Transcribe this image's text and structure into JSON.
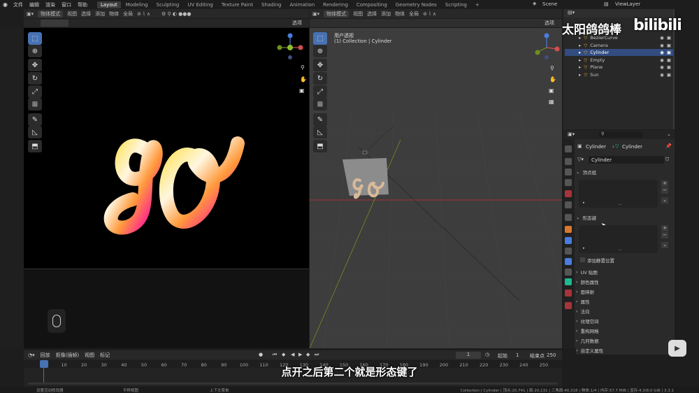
{
  "topbar": {
    "menu": [
      "文件",
      "编辑",
      "渲染",
      "窗口",
      "帮助"
    ],
    "workspaces": [
      "Layout",
      "Modeling",
      "Sculpting",
      "UV Editing",
      "Texture Paint",
      "Shading",
      "Animation",
      "Rendering",
      "Compositing",
      "Geometry Nodes",
      "Scripting"
    ],
    "active_workspace": "Layout",
    "add_tab": "+",
    "scene": "Scene",
    "view_layer": "ViewLayer"
  },
  "left_viewport": {
    "mode": "物体模式",
    "menus": [
      "视图",
      "选择",
      "添加",
      "物体"
    ],
    "transform": "全局",
    "options": "选项",
    "artwork_text": "go"
  },
  "right_viewport": {
    "mode": "物体模式",
    "menus": [
      "视图",
      "选择",
      "添加",
      "物体"
    ],
    "transform": "全局",
    "options": "选项",
    "view_name": "用户透视",
    "collection_info": "(1) Collection | Cylinder"
  },
  "outliner": {
    "items": [
      {
        "name": "BezierCurve",
        "icon_color": "#e6a43b",
        "selected": false
      },
      {
        "name": "Camera",
        "icon_color": "#e6a43b",
        "selected": false
      },
      {
        "name": "Cylinder",
        "icon_color": "#e6a43b",
        "selected": true
      },
      {
        "name": "Empty",
        "icon_color": "#e6a43b",
        "selected": false
      },
      {
        "name": "Plane",
        "icon_color": "#e6a43b",
        "selected": false
      },
      {
        "name": "Sun",
        "icon_color": "#e6a43b",
        "selected": false
      }
    ]
  },
  "watermark": {
    "channel": "太阳鸽鸽棒",
    "logo": "bilibili"
  },
  "properties": {
    "breadcrumb_object": "Cylinder",
    "breadcrumb_data": "Cylinder",
    "data_name": "Cylinder",
    "vertex_groups": "顶点组",
    "shape_keys": "形态键",
    "add_rest_position": "添加静置位置",
    "panels": [
      "UV 贴图",
      "颜色属性",
      "面映射",
      "属性",
      "法向",
      "纹理空间",
      "重构网格",
      "几何数据",
      "自定义属性"
    ]
  },
  "timeline": {
    "menus": [
      "回放",
      "抠像(插帧)",
      "视图",
      "标记"
    ],
    "current_frame": "1",
    "start_label": "起始",
    "start_value": "1",
    "end_label": "结束点",
    "end_value": "250",
    "ticks": [
      "1",
      "10",
      "20",
      "30",
      "40",
      "50",
      "60",
      "70",
      "80",
      "90",
      "100",
      "110",
      "120",
      "130",
      "140",
      "150",
      "160",
      "170",
      "180",
      "190",
      "200",
      "210",
      "220",
      "230",
      "240",
      "250"
    ]
  },
  "subtitle": "点开之后第二个就是形态键了",
  "statusbar": {
    "left": "设置活动修改器",
    "middle": "平移视图",
    "context": "上下文菜单",
    "stats": "Collection | Cylinder | 顶点:20,741 | 面:20,131 | 三角面:40,318 | 物体:1/4 | 内存:57.7 MiB | 显存:4.3/8.0 GiB | 3.3.1"
  },
  "colors": {
    "accent": "#4772b3",
    "selected_row": "#334d80",
    "red_axis": "#a8343b",
    "green_axis": "#6e8f21"
  }
}
